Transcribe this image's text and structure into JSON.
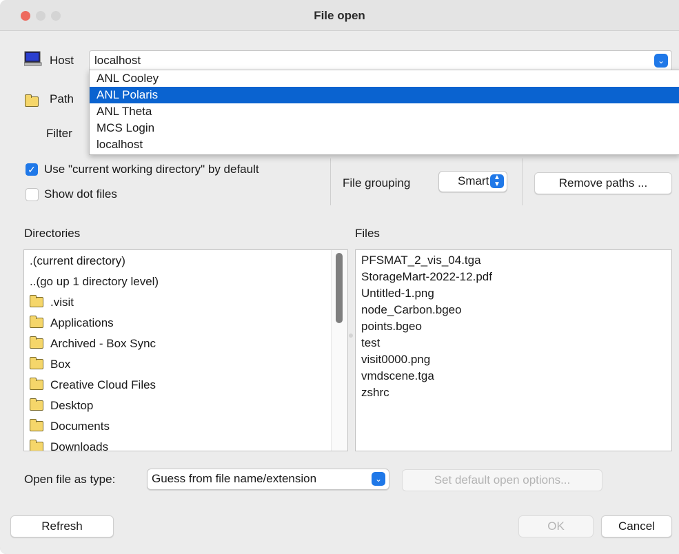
{
  "window": {
    "title": "File open",
    "traffic_colors": [
      "#ed6a5e",
      "#cfcfcf",
      "#cfcfcf"
    ]
  },
  "host": {
    "label": "Host",
    "value": "localhost",
    "options": [
      "ANL Cooley",
      "ANL Polaris",
      "ANL Theta",
      "MCS Login",
      "localhost"
    ],
    "highlighted_option": "ANL Polaris"
  },
  "path": {
    "label": "Path"
  },
  "filter": {
    "label": "Filter"
  },
  "options": {
    "use_cwd_label": "Use \"current working directory\" by default",
    "use_cwd_checked": true,
    "show_dot_label": "Show dot files",
    "show_dot_checked": false,
    "file_grouping_label": "File grouping",
    "file_grouping_value": "Smart",
    "remove_paths_label": "Remove paths ..."
  },
  "directories": {
    "header": "Directories",
    "items": [
      {
        "name": ".(current directory)",
        "folder": false
      },
      {
        "name": "..(go up 1 directory level)",
        "folder": false
      },
      {
        "name": ".visit",
        "folder": true
      },
      {
        "name": "Applications",
        "folder": true
      },
      {
        "name": "Archived - Box Sync",
        "folder": true
      },
      {
        "name": "Box",
        "folder": true
      },
      {
        "name": "Creative Cloud Files",
        "folder": true
      },
      {
        "name": "Desktop",
        "folder": true
      },
      {
        "name": "Documents",
        "folder": true
      },
      {
        "name": "Downloads",
        "folder": true
      }
    ]
  },
  "files": {
    "header": "Files",
    "items": [
      "PFSMAT_2_vis_04.tga",
      "StorageMart-2022-12.pdf",
      "Untitled-1.png",
      "node_Carbon.bgeo",
      "points.bgeo",
      "test",
      "visit0000.png",
      "vmdscene.tga",
      "zshrc"
    ]
  },
  "open_as": {
    "label": "Open file as type:",
    "value": "Guess from file name/extension",
    "set_default_label": "Set default open options..."
  },
  "buttons": {
    "refresh": "Refresh",
    "ok": "OK",
    "cancel": "Cancel"
  },
  "colors": {
    "accent": "#1f78e8",
    "selection": "#0a63d0",
    "folder": "#f5d66a"
  }
}
